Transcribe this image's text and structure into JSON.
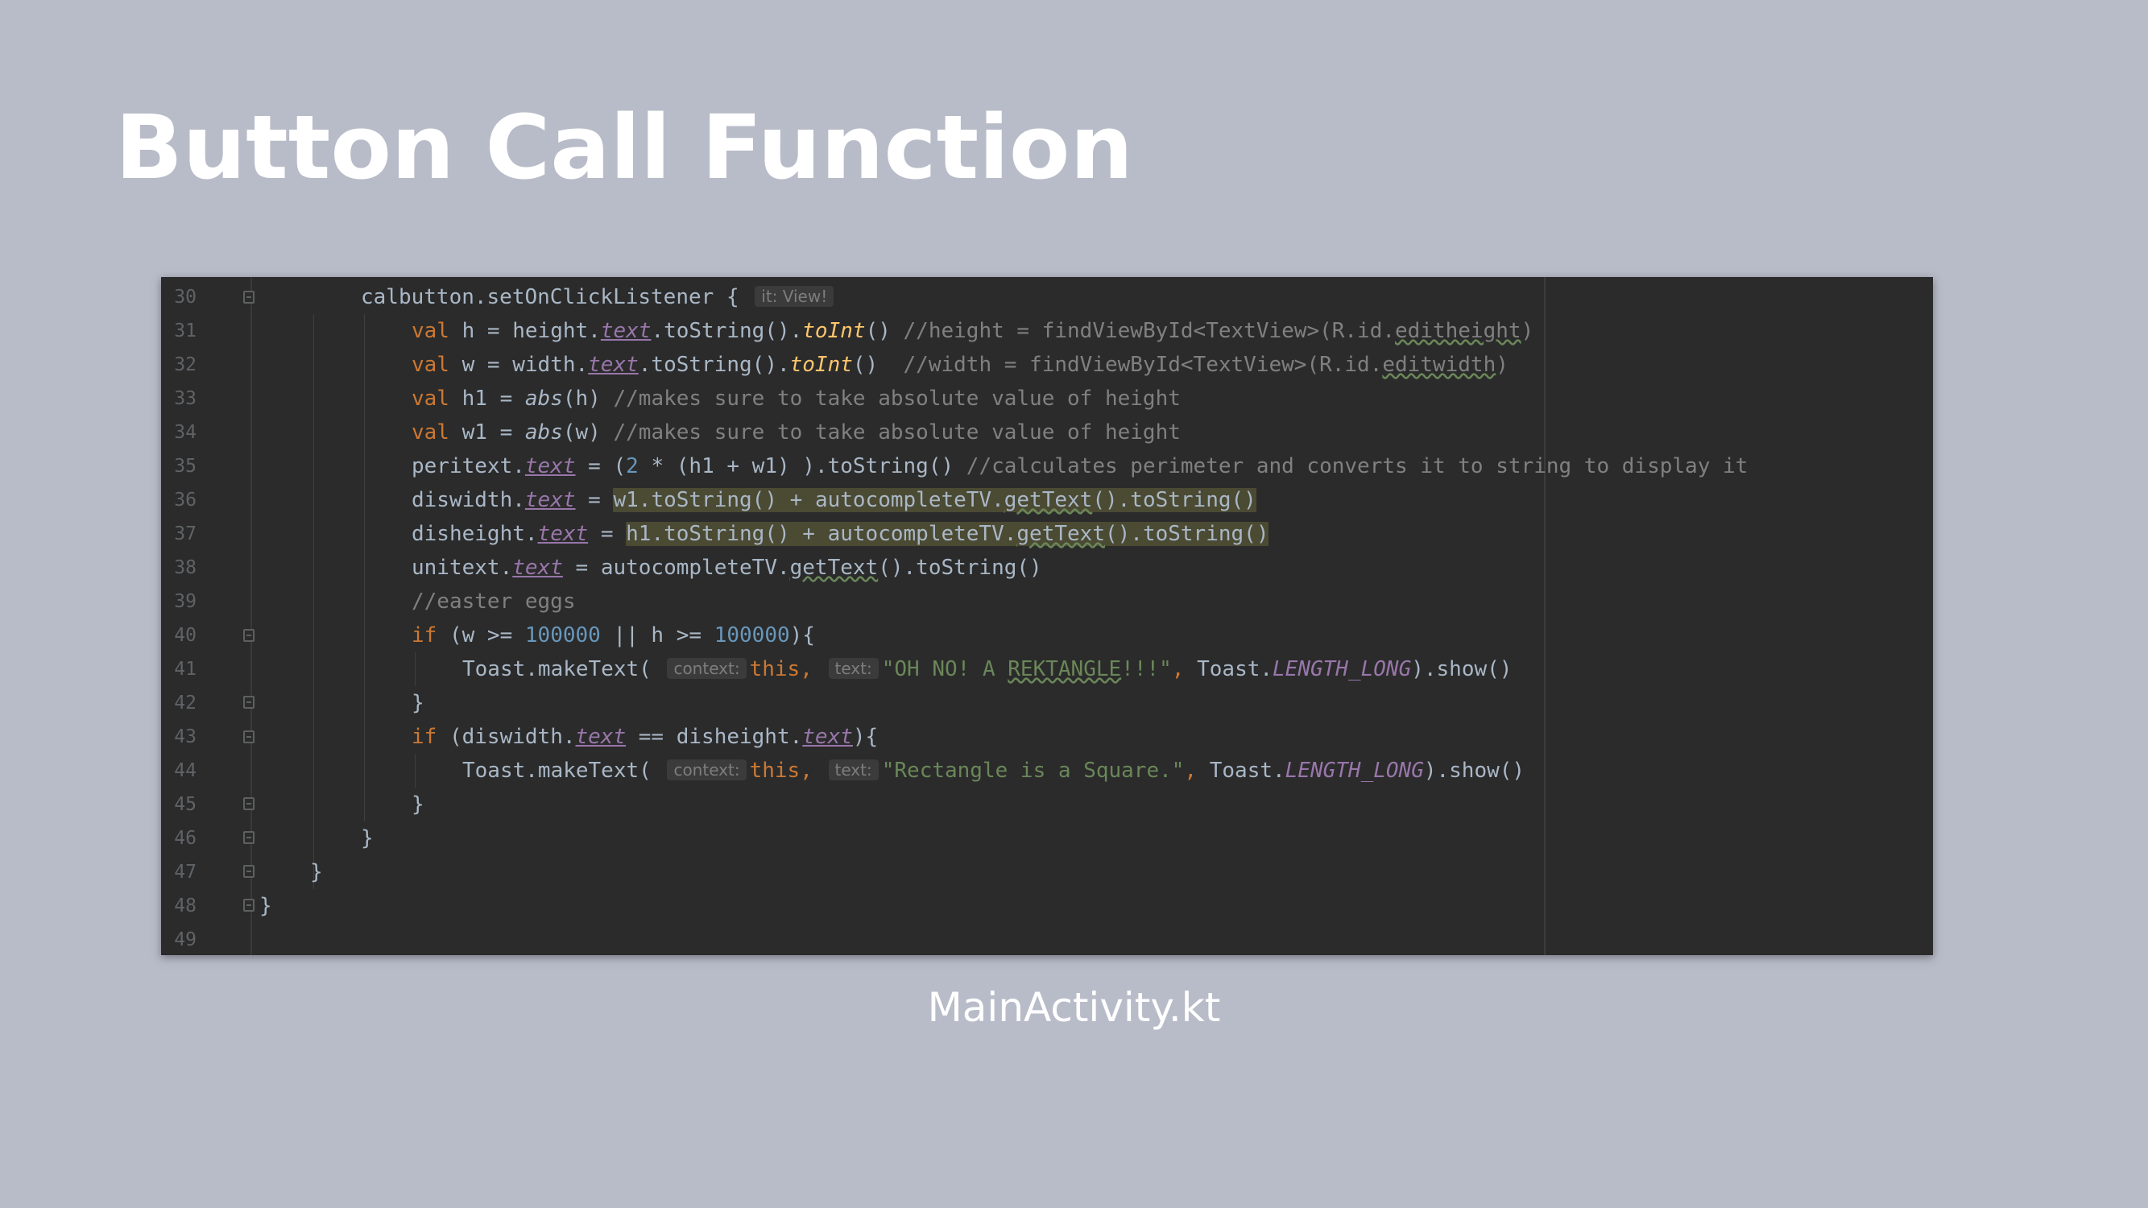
{
  "slide": {
    "title": "Button Call Function",
    "caption": "MainActivity.kt"
  },
  "colors": {
    "background": "#b8bcc8",
    "editor_bg": "#2b2b2b",
    "keyword": "#cc7832",
    "string": "#6a8759",
    "number": "#6897bb",
    "comment": "#808080",
    "property": "#9876aa",
    "function": "#ffc66d"
  },
  "editor": {
    "lines": [
      {
        "n": "30",
        "tokens": [
          [
            "t",
            "calbutton.setOnClickListener { "
          ],
          [
            "hint",
            "it: View!"
          ]
        ]
      },
      {
        "n": "31",
        "tokens": [
          [
            "kw",
            "val"
          ],
          [
            "t",
            " h = height."
          ],
          [
            "prop",
            "text"
          ],
          [
            "t",
            ".toString()."
          ],
          [
            "fn",
            "toInt"
          ],
          [
            "t",
            "() "
          ],
          [
            "cm",
            "//height = findViewById<TextView>(R.id."
          ],
          [
            "cm sq",
            "editheight"
          ],
          [
            "cm",
            ")"
          ]
        ]
      },
      {
        "n": "32",
        "tokens": [
          [
            "kw",
            "val"
          ],
          [
            "t",
            " w = width."
          ],
          [
            "prop",
            "text"
          ],
          [
            "t",
            ".toString()."
          ],
          [
            "fn",
            "toInt"
          ],
          [
            "t",
            "()  "
          ],
          [
            "cm",
            "//width = findViewById<TextView>(R.id."
          ],
          [
            "cm sq",
            "editwidth"
          ],
          [
            "cm",
            ")"
          ]
        ]
      },
      {
        "n": "33",
        "tokens": [
          [
            "kw",
            "val"
          ],
          [
            "t",
            " h1 = "
          ],
          [
            "t it",
            "abs"
          ],
          [
            "t",
            "(h) "
          ],
          [
            "cm",
            "//makes sure to take absolute value of height"
          ]
        ]
      },
      {
        "n": "34",
        "tokens": [
          [
            "kw",
            "val"
          ],
          [
            "t",
            " w1 = "
          ],
          [
            "t it",
            "abs"
          ],
          [
            "t",
            "(w) "
          ],
          [
            "cm",
            "//makes sure to take absolute value of height"
          ]
        ]
      },
      {
        "n": "35",
        "tokens": [
          [
            "t",
            "peritext."
          ],
          [
            "prop",
            "text"
          ],
          [
            "t",
            " = ("
          ],
          [
            "num",
            "2"
          ],
          [
            "t",
            " * (h1 + w1) ).toString() "
          ],
          [
            "cm",
            "//calculates perimeter and converts it to string to display it"
          ]
        ]
      },
      {
        "n": "36",
        "tokens": [
          [
            "t",
            "diswidth."
          ],
          [
            "prop",
            "text"
          ],
          [
            "t",
            " = "
          ],
          [
            "t hl",
            "w1.toString() + autocompleteTV."
          ],
          [
            "t hl sq",
            "getText"
          ],
          [
            "t hl",
            "().toString()"
          ]
        ]
      },
      {
        "n": "37",
        "tokens": [
          [
            "t",
            "disheight."
          ],
          [
            "prop",
            "text"
          ],
          [
            "t",
            " = "
          ],
          [
            "t hl",
            "h1.toString() + autocompleteTV."
          ],
          [
            "t hl sq",
            "getText"
          ],
          [
            "t hl",
            "().toString()"
          ]
        ]
      },
      {
        "n": "38",
        "tokens": [
          [
            "t",
            "unitext."
          ],
          [
            "prop",
            "text"
          ],
          [
            "t",
            " = autocompleteTV."
          ],
          [
            "t sq",
            "getText"
          ],
          [
            "t",
            "().toString()"
          ]
        ]
      },
      {
        "n": "39",
        "tokens": [
          [
            "cm",
            "//easter eggs"
          ]
        ]
      },
      {
        "n": "40",
        "tokens": [
          [
            "kw",
            "if"
          ],
          [
            "t",
            " (w >= "
          ],
          [
            "num",
            "100000"
          ],
          [
            "t",
            " || h >= "
          ],
          [
            "num",
            "100000"
          ],
          [
            "t",
            "){"
          ]
        ]
      },
      {
        "n": "41",
        "tokens": [
          [
            "t",
            "Toast.makeText( "
          ],
          [
            "hint",
            "context:"
          ],
          [
            "kw",
            "this,"
          ],
          [
            "t",
            " "
          ],
          [
            "hint",
            "text:"
          ],
          [
            "str",
            "\"OH NO! A "
          ],
          [
            "str sq",
            "REKTANGLE"
          ],
          [
            "str",
            "!!!\""
          ],
          [
            "kw",
            ","
          ],
          [
            "t",
            " Toast."
          ],
          [
            "const",
            "LENGTH_LONG"
          ],
          [
            "t",
            ").show()"
          ]
        ]
      },
      {
        "n": "42",
        "tokens": [
          [
            "t",
            "}"
          ]
        ]
      },
      {
        "n": "43",
        "tokens": [
          [
            "kw",
            "if"
          ],
          [
            "t",
            " (diswidth."
          ],
          [
            "prop",
            "text"
          ],
          [
            "t",
            " == disheight."
          ],
          [
            "prop",
            "text"
          ],
          [
            "t",
            "){"
          ]
        ]
      },
      {
        "n": "44",
        "tokens": [
          [
            "t",
            "Toast.makeText( "
          ],
          [
            "hint",
            "context:"
          ],
          [
            "kw",
            "this,"
          ],
          [
            "t",
            " "
          ],
          [
            "hint",
            "text:"
          ],
          [
            "str",
            "\"Rectangle is a Square.\""
          ],
          [
            "kw",
            ","
          ],
          [
            "t",
            " Toast."
          ],
          [
            "const",
            "LENGTH_LONG"
          ],
          [
            "t",
            ").show()"
          ]
        ]
      },
      {
        "n": "45",
        "tokens": [
          [
            "t",
            "}"
          ]
        ]
      },
      {
        "n": "46",
        "tokens": [
          [
            "t",
            "}"
          ]
        ]
      },
      {
        "n": "47",
        "tokens": [
          [
            "t",
            "}"
          ]
        ]
      },
      {
        "n": "48",
        "tokens": [
          [
            "t",
            "}"
          ]
        ]
      },
      {
        "n": "49",
        "tokens": []
      }
    ]
  }
}
